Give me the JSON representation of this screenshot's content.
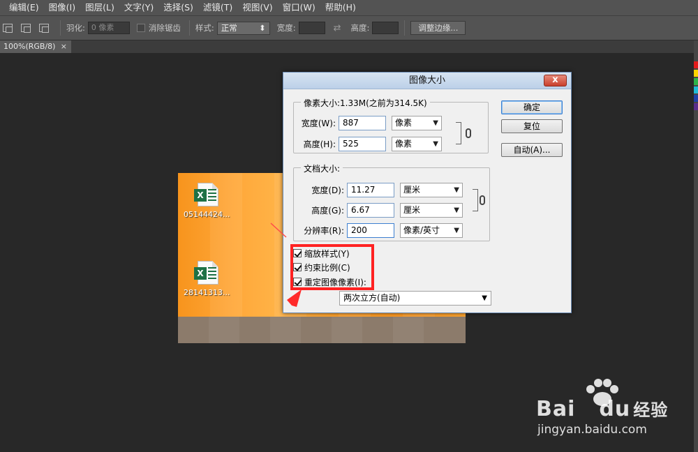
{
  "menu": [
    "编辑(E)",
    "图像(I)",
    "图层(L)",
    "文字(Y)",
    "选择(S)",
    "滤镜(T)",
    "视图(V)",
    "窗口(W)",
    "帮助(H)"
  ],
  "options": {
    "feather_label": "羽化:",
    "feather_value": "0 像素",
    "antialias_label": "消除锯齿",
    "style_label": "样式:",
    "style_value": "正常",
    "width_label": "宽度:",
    "height_label": "高度:",
    "refine_edge": "调整边缘..."
  },
  "doc_tab": {
    "label": "100%(RGB/8)",
    "close": "×"
  },
  "desktop_icons": [
    {
      "label": "05144424..."
    },
    {
      "label": "28141313..."
    }
  ],
  "dialog": {
    "title": "图像大小",
    "close": "x",
    "pixel_dimensions": {
      "legend": "像素大小:1.33M(之前为314.5K)",
      "width_label": "宽度(W):",
      "width_value": "887",
      "width_unit": "像素",
      "height_label": "高度(H):",
      "height_value": "525",
      "height_unit": "像素"
    },
    "document_size": {
      "legend": "文档大小:",
      "width_label": "宽度(D):",
      "width_value": "11.27",
      "width_unit": "厘米",
      "height_label": "高度(G):",
      "height_value": "6.67",
      "height_unit": "厘米",
      "resolution_label": "分辨率(R):",
      "resolution_value": "200",
      "resolution_unit": "像素/英寸"
    },
    "buttons": {
      "ok": "确定",
      "reset": "复位",
      "auto": "自动(A)..."
    },
    "checkboxes": {
      "scale_styles": "缩放样式(Y)",
      "constrain": "约束比例(C)",
      "resample": "重定图像像素(I):"
    },
    "resample_method": "两次立方(自动)"
  },
  "watermark": {
    "brand": "Bai",
    "brand2": "du",
    "brand_cn": "经验",
    "url": "jingyan.baidu.com"
  },
  "colors": {
    "accent_red": "#ff2222",
    "ui_dark": "#535353",
    "canvas_bg": "#282828"
  }
}
